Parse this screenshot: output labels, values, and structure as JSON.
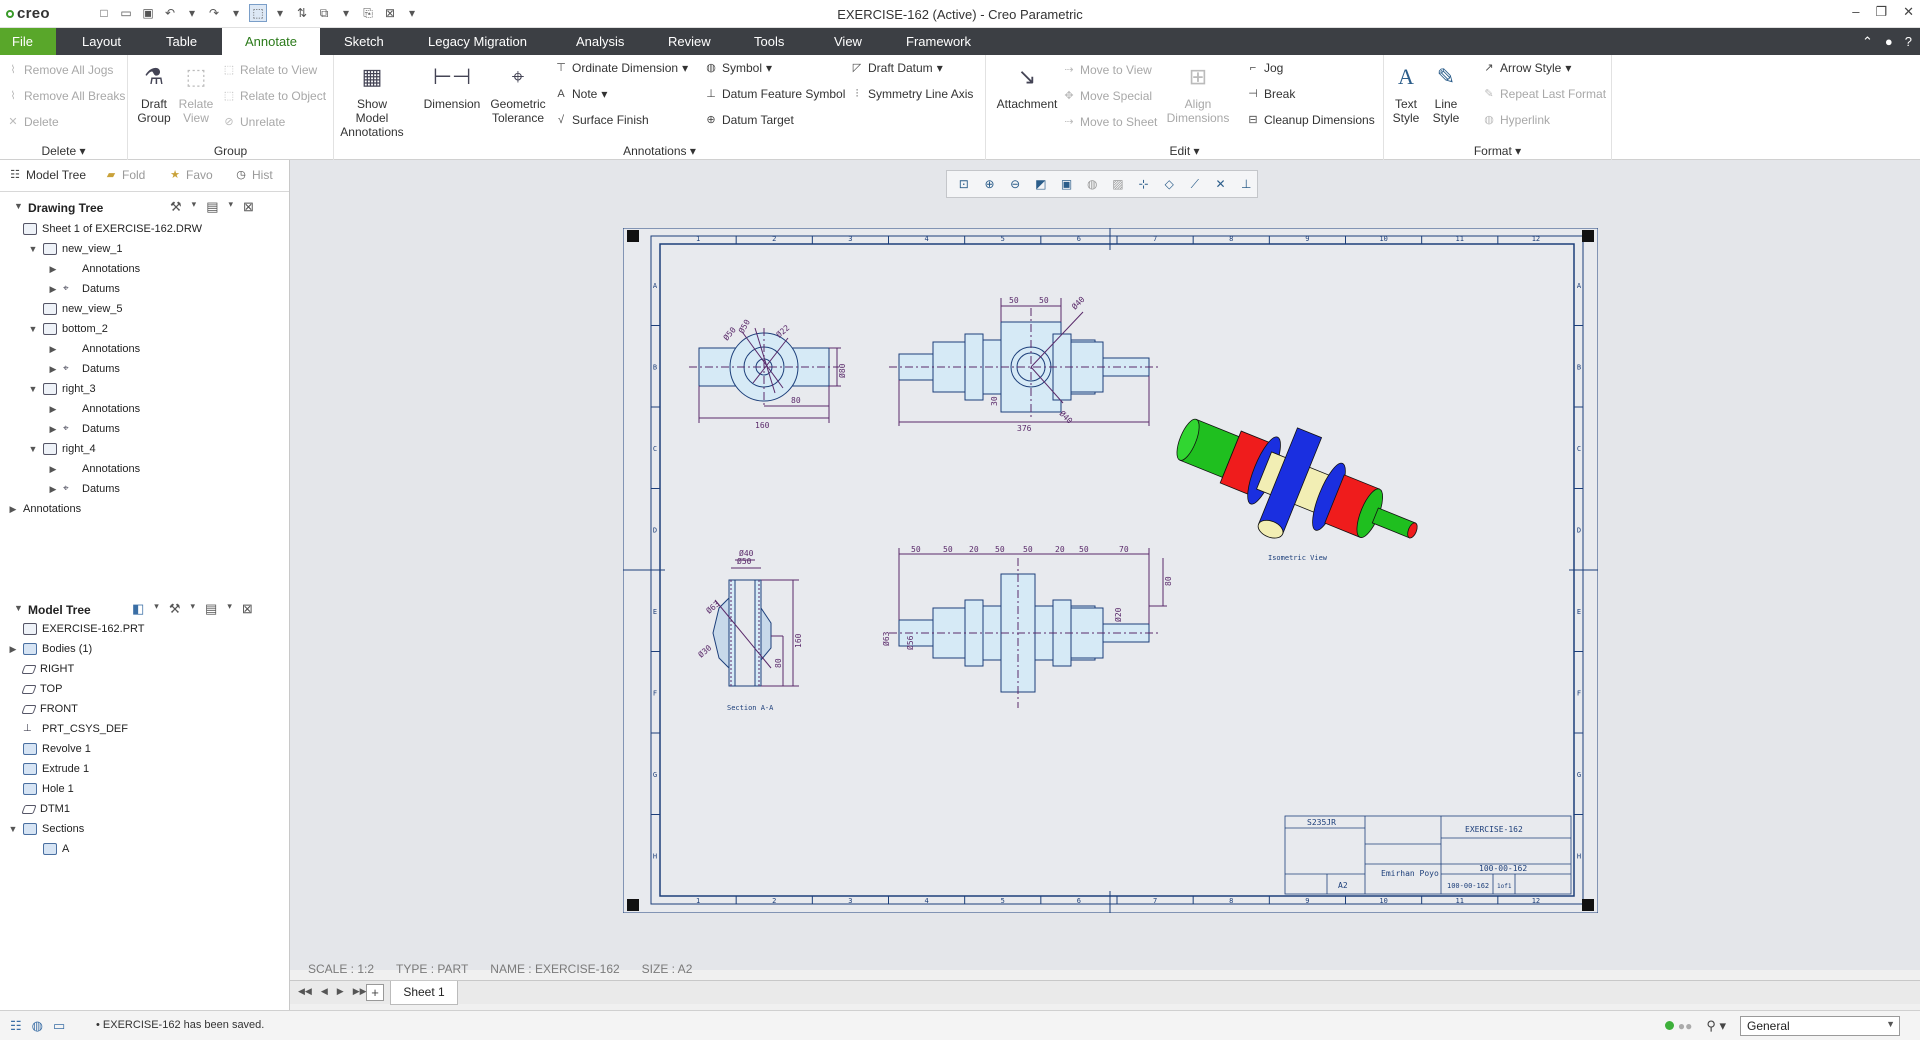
{
  "app": {
    "logo": "creo",
    "window_title": "EXERCISE-162 (Active) - Creo Parametric",
    "window_controls": [
      "–",
      "❐",
      "✕"
    ]
  },
  "ribbon_tabs": [
    "File",
    "Layout",
    "Table",
    "Annotate",
    "Sketch",
    "Legacy Migration",
    "Analysis",
    "Review",
    "Tools",
    "View",
    "Framework"
  ],
  "ribbon": {
    "delete": {
      "label": "Delete",
      "items": [
        "Remove All Jogs",
        "Remove All Breaks",
        "Delete"
      ]
    },
    "group": {
      "label": "Group",
      "draft_group": "Draft\nGroup",
      "relate_view": "Relate\nView",
      "items": [
        "Relate to View",
        "Relate to Object",
        "Unrelate"
      ]
    },
    "annotations": {
      "label": "Annotations",
      "show_model": "Show Model\nAnnotations",
      "dimension": "Dimension",
      "geometric_tolerance": "Geometric\nTolerance",
      "col1": [
        "Ordinate Dimension",
        "Note",
        "Surface Finish"
      ],
      "col2": [
        "Symbol",
        "Datum Feature Symbol",
        "Datum Target"
      ],
      "col3": [
        "Draft Datum",
        "Symmetry Line Axis"
      ]
    },
    "edit": {
      "label": "Edit",
      "attachment": "Attachment",
      "items_disabled": [
        "Move to View",
        "Move Special",
        "Move to Sheet"
      ],
      "align": "Align\nDimensions",
      "items": [
        "Jog",
        "Break",
        "Cleanup Dimensions"
      ]
    },
    "format": {
      "label": "Format",
      "text_style": "Text\nStyle",
      "line_style": "Line\nStyle",
      "items": [
        "Arrow Style",
        "Repeat Last Format",
        "Hyperlink"
      ]
    }
  },
  "panel_tabs": [
    "Model Tree",
    "Fold",
    "Favo",
    "Hist"
  ],
  "drawing_tree": {
    "title": "Drawing Tree",
    "nodes": [
      {
        "label": "Sheet 1 of EXERCISE-162.DRW",
        "level": 0,
        "tw": ""
      },
      {
        "label": "new_view_1",
        "level": 1,
        "tw": "▼"
      },
      {
        "label": "Annotations",
        "level": 2,
        "tw": "▶"
      },
      {
        "label": "Datums",
        "level": 2,
        "tw": "▶"
      },
      {
        "label": "new_view_5",
        "level": 1,
        "tw": ""
      },
      {
        "label": "bottom_2",
        "level": 1,
        "tw": "▼"
      },
      {
        "label": "Annotations",
        "level": 2,
        "tw": "▶"
      },
      {
        "label": "Datums",
        "level": 2,
        "tw": "▶"
      },
      {
        "label": "right_3",
        "level": 1,
        "tw": "▼"
      },
      {
        "label": "Annotations",
        "level": 2,
        "tw": "▶"
      },
      {
        "label": "Datums",
        "level": 2,
        "tw": "▶"
      },
      {
        "label": "right_4",
        "level": 1,
        "tw": "▼"
      },
      {
        "label": "Annotations",
        "level": 2,
        "tw": "▶"
      },
      {
        "label": "Datums",
        "level": 2,
        "tw": "▶"
      },
      {
        "label": "Annotations",
        "level": 0,
        "tw": "▶"
      }
    ]
  },
  "model_tree": {
    "title": "Model Tree",
    "nodes": [
      {
        "label": "EXERCISE-162.PRT",
        "level": 0,
        "tw": ""
      },
      {
        "label": "Bodies (1)",
        "level": 0,
        "tw": "▶"
      },
      {
        "label": "RIGHT",
        "level": 0,
        "tw": ""
      },
      {
        "label": "TOP",
        "level": 0,
        "tw": ""
      },
      {
        "label": "FRONT",
        "level": 0,
        "tw": ""
      },
      {
        "label": "PRT_CSYS_DEF",
        "level": 0,
        "tw": ""
      },
      {
        "label": "Revolve 1",
        "level": 0,
        "tw": ""
      },
      {
        "label": "Extrude 1",
        "level": 0,
        "tw": ""
      },
      {
        "label": "Hole 1",
        "level": 0,
        "tw": ""
      },
      {
        "label": "DTM1",
        "level": 0,
        "tw": ""
      },
      {
        "label": "Sections",
        "level": 0,
        "tw": "▼"
      },
      {
        "label": "A",
        "level": 1,
        "tw": ""
      }
    ]
  },
  "drawing": {
    "col_numbers": [
      "1",
      "2",
      "3",
      "4",
      "5",
      "6",
      "7",
      "8",
      "9",
      "10",
      "11",
      "12"
    ],
    "row_letters": [
      "A",
      "B",
      "C",
      "D",
      "E",
      "F",
      "G",
      "H"
    ],
    "dims_top_left": {
      "d1": "Ø50",
      "d2": "Ø80",
      "d3": "Ø22",
      "w": "160",
      "h": "80",
      "r": "Ø50"
    },
    "dims_top_front": {
      "a": "50",
      "b": "50",
      "dia": "Ø40",
      "len": "376",
      "h": "30",
      "hole": "Ø40"
    },
    "dims_bottom_front": [
      "50",
      "50",
      "20",
      "50",
      "50",
      "20",
      "50",
      "70"
    ],
    "dims_bottom_misc": {
      "d30": "Ø20",
      "d80": "80",
      "d63": "Ø63",
      "d56": "Ø56"
    },
    "dims_section": {
      "top1": "Ø50",
      "top2": "Ø40",
      "r1": "Ø63",
      "r2": "Ø30",
      "h1": "80",
      "h2": "160"
    },
    "section_label": "Section A-A",
    "iso_label": "Isometric View",
    "title_block": {
      "material": "S235JR",
      "name": "EXERCISE-162",
      "company": "Emirhan Poyo",
      "size": "A2",
      "code": "100-00-162",
      "code2": "100-00-162",
      "sheet": "1of1"
    }
  },
  "sheet_info": {
    "scale": "SCALE : 1:2",
    "type": "TYPE : PART",
    "name": "NAME : EXERCISE-162",
    "size": "SIZE : A2"
  },
  "sheet_tabs": {
    "active": "Sheet 1",
    "add": "+"
  },
  "status": {
    "message": "EXERCISE-162 has been saved.",
    "filter": "General"
  },
  "colors": {
    "accent": "#59a72a",
    "tab_bar": "#3c3f44",
    "drawing_line": "#1d3f7a",
    "dimension": "#5a2a6a"
  }
}
